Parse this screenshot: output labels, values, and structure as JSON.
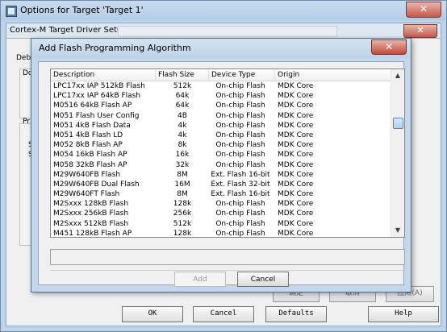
{
  "outer_window": {
    "title": "Options for Target 'Target 1'",
    "close_label": "✕",
    "inner_title": "Cortex-M Target Driver Setup",
    "inner_close_label": "✕",
    "ghost_labels": {
      "debug": "Debu",
      "do": "Do",
      "pr": "Pr",
      "s1": "S",
      "s2": "S"
    },
    "ghost_buttons": {
      "ok": "确定",
      "cancel": "取消",
      "apply": "应用(A)"
    },
    "bottom_buttons": {
      "ok": "OK",
      "cancel": "Cancel",
      "defaults": "Defaults",
      "help": "Help"
    }
  },
  "dialog": {
    "title": "Add Flash Programming Algorithm",
    "close_label": "✕",
    "columns": [
      "Description",
      "Flash Size",
      "Device Type",
      "Origin"
    ],
    "rows": [
      [
        "LPC17xx IAP 512kB Flash",
        "512k",
        "On-chip Flash",
        "MDK Core"
      ],
      [
        "LPC17xx IAP 64kB Flash",
        "64k",
        "On-chip Flash",
        "MDK Core"
      ],
      [
        "M0516 64kB Flash AP",
        "64k",
        "On-chip Flash",
        "MDK Core"
      ],
      [
        "M051 Flash User Config",
        "4B",
        "On-chip Flash",
        "MDK Core"
      ],
      [
        "M051 4kB Flash Data",
        "4k",
        "On-chip Flash",
        "MDK Core"
      ],
      [
        "M051 4kB Flash LD",
        "4k",
        "On-chip Flash",
        "MDK Core"
      ],
      [
        "M052 8kB Flash AP",
        "8k",
        "On-chip Flash",
        "MDK Core"
      ],
      [
        "M054 16kB Flash AP",
        "16k",
        "On-chip Flash",
        "MDK Core"
      ],
      [
        "M058 32kB Flash AP",
        "32k",
        "On-chip Flash",
        "MDK Core"
      ],
      [
        "M29W640FB Flash",
        "8M",
        "Ext. Flash 16-bit",
        "MDK Core"
      ],
      [
        "M29W640FB Dual Flash",
        "16M",
        "Ext. Flash 32-bit",
        "MDK Core"
      ],
      [
        "M29W640FT Flash",
        "8M",
        "Ext. Flash 16-bit",
        "MDK Core"
      ],
      [
        "M2Sxxx 128kB Flash",
        "128k",
        "On-chip Flash",
        "MDK Core"
      ],
      [
        "M2Sxxx 256kB Flash",
        "256k",
        "On-chip Flash",
        "MDK Core"
      ],
      [
        "M2Sxxx 512kB Flash",
        "512k",
        "On-chip Flash",
        "MDK Core"
      ],
      [
        "M451 128kB Flash AP",
        "128k",
        "On-chip Flash",
        "MDK Core"
      ]
    ],
    "scroll_up": "▲",
    "scroll_down": "▼",
    "path_value": "",
    "add_label": "Add",
    "cancel_label": "Cancel"
  }
}
